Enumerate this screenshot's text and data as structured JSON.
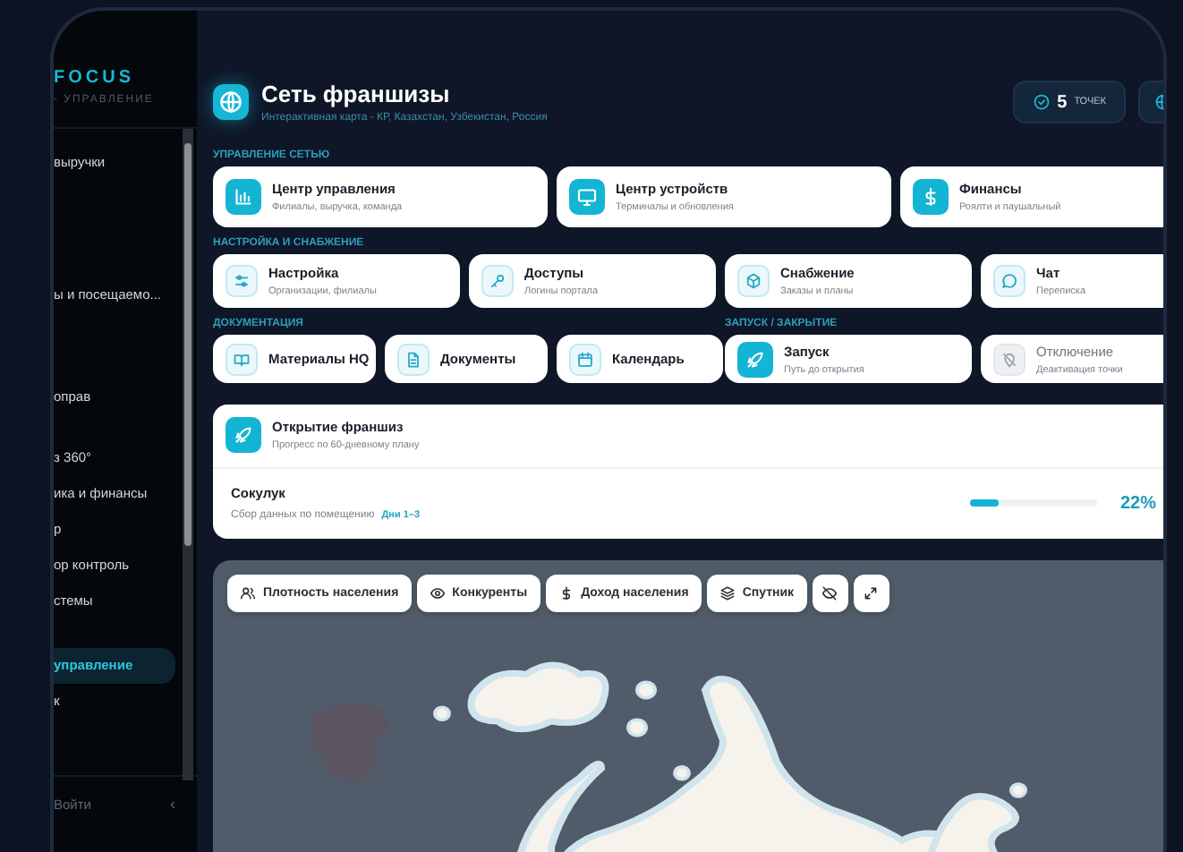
{
  "sidebar": {
    "logo": "FOCUS",
    "logo_subtitle": "- УПРАВЛЕНИЕ",
    "items": [
      {
        "label": "выручки",
        "selected": false
      },
      {
        "label": "ы и посещаемо...",
        "selected": false
      },
      {
        "label": "оправ",
        "selected": false
      },
      {
        "label": "з 360°",
        "selected": false
      },
      {
        "label": "ика и финансы",
        "selected": false
      },
      {
        "label": "р",
        "selected": false
      },
      {
        "label": "ор контроль",
        "selected": false
      },
      {
        "label": "стемы",
        "selected": false
      },
      {
        "label": "управление",
        "selected": true
      },
      {
        "label": "к",
        "selected": false
      }
    ],
    "login": "Войти",
    "collapse": "‹"
  },
  "header": {
    "title": "Сеть франшизы",
    "subtitle": "Интерактивная карта - КР, Казахстан, Узбекистан, Россия",
    "stat_value": "5",
    "stat_label": "ТОЧЕК"
  },
  "sections": [
    {
      "title": "УПРАВЛЕНИЕ СЕТЬЮ",
      "cards": [
        {
          "title": "Центр управления",
          "subtitle": "Филиалы, выручка, команда",
          "highlighted": true,
          "disabled": false
        },
        {
          "title": "Центр устройств",
          "subtitle": "Терминалы и обновления",
          "highlighted": true,
          "disabled": false
        },
        {
          "title": "Финансы",
          "subtitle": "Роялти и паушальный",
          "highlighted": true,
          "disabled": false
        }
      ]
    },
    {
      "title": "НАСТРОЙКА И СНАБЖЕНИЕ",
      "cards": [
        {
          "title": "Настройка",
          "subtitle": "Организации, филиалы",
          "highlighted": false,
          "disabled": false
        },
        {
          "title": "Доступы",
          "subtitle": "Логины портала",
          "highlighted": false,
          "disabled": false
        },
        {
          "title": "Снабжение",
          "subtitle": "Заказы и планы",
          "highlighted": false,
          "disabled": false
        },
        {
          "title": "Чат",
          "subtitle": "Переписка",
          "highlighted": false,
          "disabled": false
        }
      ]
    },
    {
      "title": "ДОКУМЕНТАЦИЯ",
      "cards": [
        {
          "title": "Материалы HQ",
          "highlighted": false,
          "disabled": false
        },
        {
          "title": "Документы",
          "highlighted": false,
          "disabled": false
        },
        {
          "title": "Календарь",
          "highlighted": false,
          "disabled": false
        }
      ]
    },
    {
      "title": "ЗАПУСК / ЗАКРЫТИЕ",
      "cards": [
        {
          "title": "Запуск",
          "subtitle": "Путь до открытия",
          "highlighted": true,
          "disabled": false
        },
        {
          "title": "Отключение",
          "subtitle": "Деактивация точки",
          "highlighted": false,
          "disabled": true
        }
      ]
    }
  ],
  "progress": {
    "title": "Открытие франшиз",
    "subtitle": "Прогресс по 60-дневному плану",
    "rows": [
      {
        "name": "Сокулук",
        "detail": "Сбор данных по помещению",
        "tag": "Дни 1–3",
        "level": 0.22,
        "percent": "22%"
      }
    ]
  },
  "map": {
    "layers": [
      {
        "label": "Плотность населения",
        "selected": false
      },
      {
        "label": "Конкуренты",
        "selected": false
      },
      {
        "label": "Доход населения",
        "selected": false
      },
      {
        "label": "Спутник",
        "selected": false
      }
    ]
  }
}
